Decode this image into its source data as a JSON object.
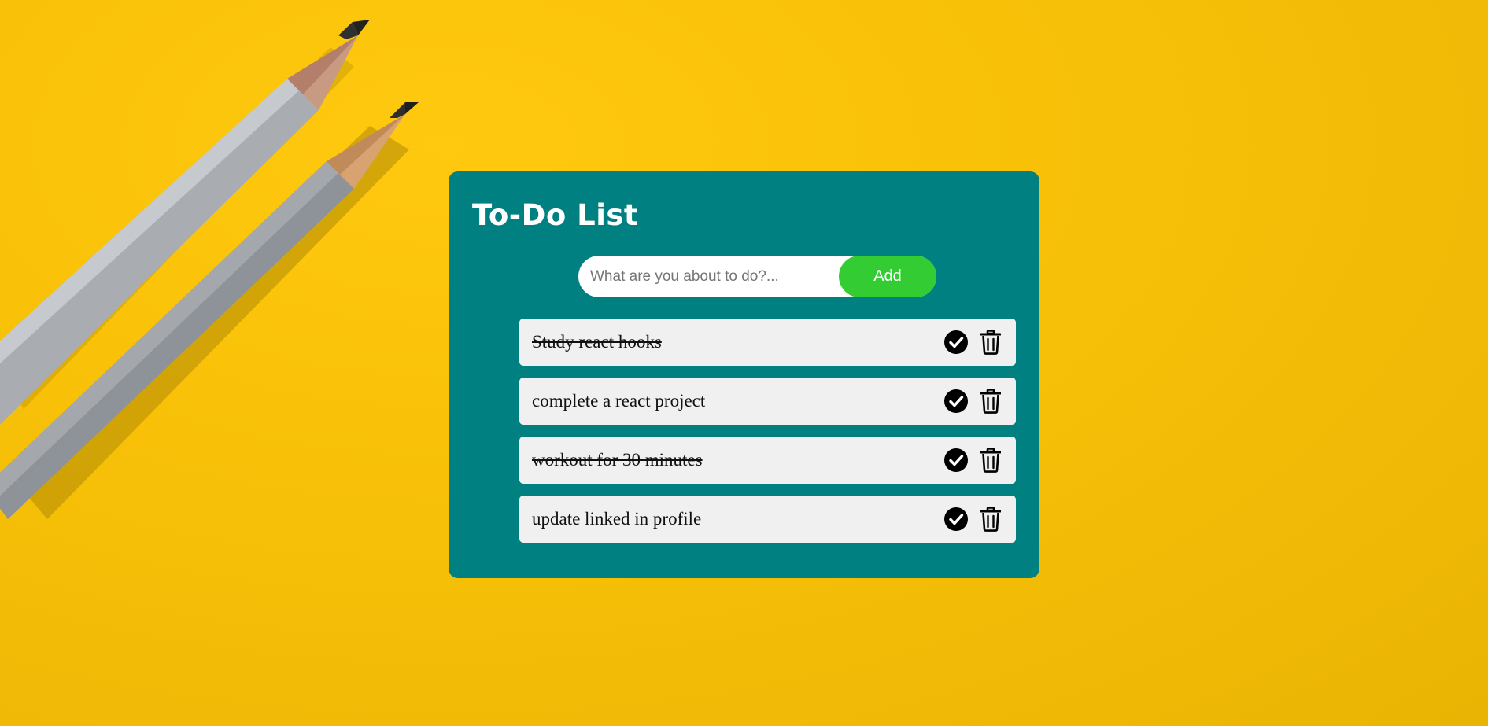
{
  "todo": {
    "title": "To-Do List",
    "input_placeholder": "What are you about to do?...",
    "input_value": "",
    "add_label": "Add",
    "accent_color": "#008080",
    "add_button_color": "#33cc33",
    "background_color": "#f8c108",
    "tasks": [
      {
        "text": "Study react hooks",
        "completed": true
      },
      {
        "text": "complete a react project",
        "completed": false
      },
      {
        "text": "workout for 30 minutes",
        "completed": true
      },
      {
        "text": "update linked in profile",
        "completed": false
      }
    ],
    "icons": {
      "check": "check-circle-icon",
      "delete": "trash-icon"
    }
  }
}
